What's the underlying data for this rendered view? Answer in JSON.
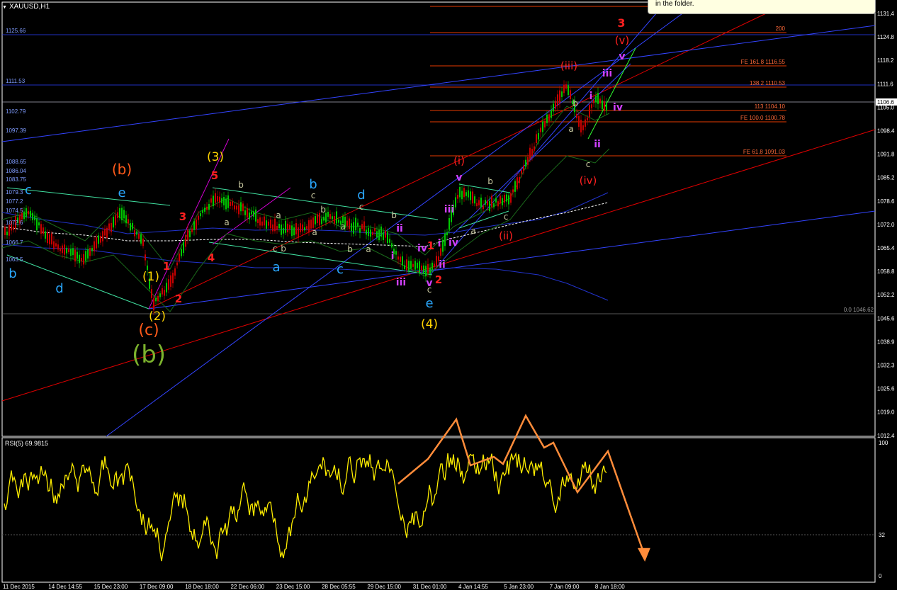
{
  "symbol": "XAUUSD,H1",
  "tooltip": "in the folder.",
  "rsi_label": "RSI(5) 69.9815",
  "colors": {
    "bg": "#000000",
    "grid": "#ffffff",
    "bull": "#00c800",
    "bear": "#c80000"
  },
  "price_axis": [
    "1131.4",
    "1124.8",
    "1118.2",
    "1111.6",
    "1105.0",
    "1098.4",
    "1091.8",
    "1085.2",
    "1078.6",
    "1072.0",
    "1065.4",
    "1058.8",
    "1052.2",
    "1045.6",
    "1038.9",
    "1032.3",
    "1025.6",
    "1019.0",
    "1012.4"
  ],
  "current_price": "1106.6",
  "rsi_axis": [
    "100",
    "32",
    "0"
  ],
  "time_axis": [
    "11 Dec 2015",
    "14 Dec 14:55",
    "15 Dec 23:00",
    "17 Dec 09:00",
    "18 Dec 18:00",
    "22 Dec 06:00",
    "23 Dec 15:00",
    "28 Dec 05:55",
    "29 Dec 15:00",
    "31 Dec 01:00",
    "4 Jan 14:55",
    "5 Jan 23:00",
    "7 Jan 09:00",
    "8 Jan 18:00"
  ],
  "hline_left": [
    "1125.66",
    "1111.53",
    "1102.79",
    "1097.39",
    "1088.65",
    "1086.04",
    "1083.75",
    "1079.3",
    "1077.2",
    "1074.5",
    "1072.6",
    "1066.7",
    "1063.5"
  ],
  "fib": [
    "200",
    "FE 161.8 1116.55",
    "138.2 1110.53",
    "113 1104.10",
    "FE 100.0 1100.78",
    "FE 61.8 1091.03",
    "0.0 1046.62"
  ],
  "waves": {
    "b_big": "(b)",
    "c_paren": "(c)",
    "b_paren": "(b)",
    "w1": "(1)",
    "w2": "(2)",
    "w3": "(3)",
    "w4": "(4)",
    "i_paren": "(i)",
    "ii_paren": "(ii)",
    "iii_paren": "(iii)",
    "iv_paren": "(iv)",
    "v_paren": "(v)",
    "three_top": "3",
    "r1": "1",
    "r2": "2",
    "r3": "3",
    "r4": "4",
    "r5": "5",
    "r1b": "1",
    "r2b": "2",
    "b": "b",
    "c": "c",
    "d": "d",
    "e": "e",
    "a": "a",
    "i": "i",
    "ii": "ii",
    "iii": "iii",
    "iv": "iv",
    "v": "v"
  }
}
